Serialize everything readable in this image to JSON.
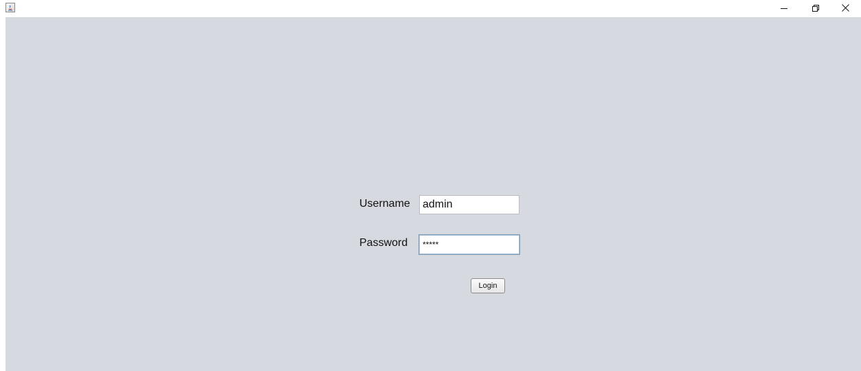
{
  "window": {
    "icon": "java-icon",
    "controls": {
      "minimize_icon": "minimize-icon",
      "maximize_icon": "restore-icon",
      "close_icon": "close-icon"
    }
  },
  "login_form": {
    "username_label": "Username",
    "username_value": "admin",
    "password_label": "Password",
    "password_value": "*****",
    "login_button": "Login"
  },
  "colors": {
    "client_background": "#d6d9e0",
    "titlebar_background": "#ffffff",
    "focused_field_border": "#7f9db9"
  }
}
